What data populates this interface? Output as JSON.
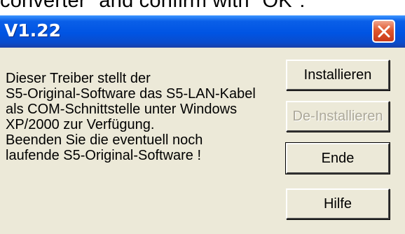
{
  "background_caption": "converter\" and confirm with \"OK\":",
  "window": {
    "title": "V1.22",
    "close_icon": "close-icon",
    "titlebar_color": "#0054e3",
    "close_color": "#e0582e"
  },
  "message_lines": [
    "Dieser Treiber stellt der",
    "S5-Original-Software das S5-LAN-Kabel",
    "als COM-Schnittstelle unter Windows",
    "XP/2000 zur Verfügung.",
    "Beenden Sie die eventuell noch",
    "laufende S5-Original-Software !"
  ],
  "buttons": {
    "install": "Installieren",
    "uninstall": "De-Installieren",
    "end": "Ende",
    "help": "Hilfe"
  }
}
